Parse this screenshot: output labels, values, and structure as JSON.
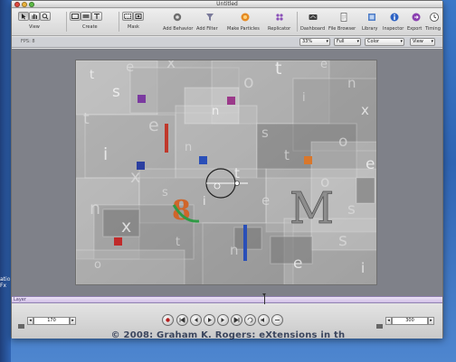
{
  "window": {
    "title": "Untitled"
  },
  "toolbar": {
    "groups": [
      {
        "label": "View"
      },
      {
        "label": "Create"
      },
      {
        "label": "Mask"
      }
    ],
    "actions": [
      {
        "label": "Add Behavior",
        "icon": "gear-icon"
      },
      {
        "label": "Add Filter",
        "icon": "filter-icon"
      },
      {
        "label": "Make Particles",
        "icon": "particles-icon"
      },
      {
        "label": "Replicator",
        "icon": "replicator-icon"
      },
      {
        "label": "Dashboard",
        "icon": "dashboard-icon"
      },
      {
        "label": "File Browser",
        "icon": "file-browser-icon"
      },
      {
        "label": "Library",
        "icon": "library-icon"
      },
      {
        "label": "Inspector",
        "icon": "inspector-icon"
      },
      {
        "label": "Export",
        "icon": "export-icon"
      },
      {
        "label": "Timing",
        "icon": "timing-icon"
      }
    ],
    "zoom_value": "33%",
    "quality_value": "Full",
    "color_value": "Color",
    "view_value": "View"
  },
  "subbar": {
    "fps": "FPS: 8"
  },
  "timeline": {
    "label": "Layer"
  },
  "bottom": {
    "start_frame": "170",
    "end_frame": "300"
  },
  "canvas_letters": [
    "t",
    "e",
    "x",
    "t",
    "e",
    "n",
    "s",
    "o",
    "i",
    "x",
    "t",
    "e",
    "n",
    "s",
    "o",
    "i",
    "n",
    "t",
    "e",
    "x",
    "s",
    "t",
    "o",
    "n",
    "i",
    "e",
    "s",
    "x",
    "t",
    "n",
    "e",
    "s",
    "o",
    "i"
  ],
  "canvas_features": {
    "big_letter": "M",
    "number": "8"
  },
  "copyright": "© 2008: Graham K. Rogers: eXtensions in th",
  "desktop_fragment": [
    "atio",
    "Fx"
  ],
  "colors": {
    "timeline": "#d0bfe6",
    "accent_red": "#c0382b",
    "accent_blue": "#2a4fb8"
  }
}
